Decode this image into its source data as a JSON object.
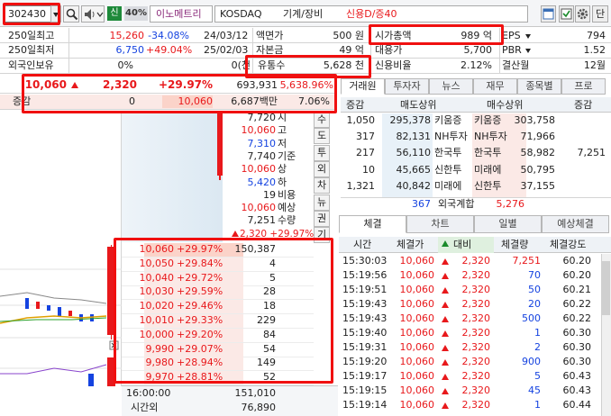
{
  "toolbar": {
    "code": "302430",
    "badge_sin": "신",
    "margin": "40%",
    "name": "이노메트리",
    "market": "KOSDAQ",
    "sector": "기계/장비",
    "credit": "신용D/증40",
    "dan": "단"
  },
  "info": {
    "row1": {
      "label": "250일최고",
      "price": "15,260",
      "pct": "-34.08%",
      "date": "24/03/12",
      "k2": "액면가",
      "v2": "500 원",
      "k3": "시가총액",
      "v3": "989 억",
      "k4": "EPS",
      "v4": "794"
    },
    "row2": {
      "label": "250일최저",
      "price": "6,750",
      "pct": "+49.04%",
      "date": "25/02/03",
      "k2": "자본금",
      "v2": "49 억",
      "k3": "대용가",
      "v3": "5,700",
      "k4": "PBR",
      "v4": "1.52"
    },
    "row3": {
      "label": "외국인보유",
      "v1": "0%",
      "v1b": "0(천",
      "k2": "유통수",
      "v2": "5,628 천",
      "k3": "신용비율",
      "v3": "2.12%",
      "k4": "결산월",
      "v4": "12월"
    }
  },
  "quote": {
    "price": "10,060",
    "change": "2,320",
    "change_pct": "+29.97%",
    "volume": "693,931",
    "vol_pct": "5,638.96%",
    "delta_label": "증감",
    "delta_v1": "0",
    "delta_v2": "10,060",
    "amount": "6,687백만",
    "ratio": "7.06%"
  },
  "summary": [
    {
      "v": "7,720",
      "k": "시"
    },
    {
      "v": "10,060",
      "k": "고"
    },
    {
      "v": "7,310",
      "k": "저"
    },
    {
      "v": "7,740",
      "k": "기준"
    },
    {
      "v": "10,060",
      "k": "상"
    },
    {
      "v": "5,420",
      "k": "하"
    },
    {
      "v": "19",
      "k": "비용"
    },
    {
      "v": "10,060",
      "k": "예상"
    },
    {
      "v": "7,251",
      "k": "수량"
    },
    {
      "v": "2,320 +29.97%",
      "k": ""
    }
  ],
  "vtabs": [
    "수",
    "도",
    "투",
    "외",
    "차",
    "뉴",
    "권",
    "기"
  ],
  "orderbook": [
    {
      "price": "10,060",
      "pct": "+29.97%",
      "qty": "150,387"
    },
    {
      "price": "10,050",
      "pct": "+29.84%",
      "qty": "4"
    },
    {
      "price": "10,040",
      "pct": "+29.72%",
      "qty": "5"
    },
    {
      "price": "10,030",
      "pct": "+29.59%",
      "qty": "28"
    },
    {
      "price": "10,020",
      "pct": "+29.46%",
      "qty": "18"
    },
    {
      "price": "10,010",
      "pct": "+29.33%",
      "qty": "229"
    },
    {
      "price": "10,000",
      "pct": "+29.20%",
      "qty": "84"
    },
    {
      "price": "9,990",
      "pct": "+29.07%",
      "qty": "54"
    },
    {
      "price": "9,980",
      "pct": "+28.94%",
      "qty": "149"
    },
    {
      "price": "9,970",
      "pct": "+28.81%",
      "qty": "52"
    }
  ],
  "ob_footer": {
    "time": "16:00:00",
    "time_label": "시간외",
    "total1": "151,010",
    "total2": "76,890"
  },
  "right_tabs": [
    "거래원",
    "투자자",
    "뉴스",
    "재무",
    "종목별",
    "프로"
  ],
  "broker_head": {
    "delta": "증감",
    "sell": "매도상위",
    "buy": "매수상위",
    "delta2": "증감"
  },
  "brokers": [
    {
      "sd": "1,050",
      "sq": "295,378",
      "sn": "키움증",
      "bn": "키움증",
      "bq": "303,758",
      "bd": ""
    },
    {
      "sd": "317",
      "sq": "82,131",
      "sn": "NH투자",
      "bn": "NH투자",
      "bq": "71,966",
      "bd": ""
    },
    {
      "sd": "217",
      "sq": "56,110",
      "sn": "한국투",
      "bn": "한국투",
      "bq": "58,982",
      "bd": "7,251"
    },
    {
      "sd": "10",
      "sq": "45,665",
      "sn": "신한투",
      "bn": "미래에",
      "bq": "50,795",
      "bd": ""
    },
    {
      "sd": "1,321",
      "sq": "40,842",
      "sn": "미래에",
      "bn": "신한투",
      "bq": "37,155",
      "bd": ""
    }
  ],
  "foreign": {
    "sell": "367",
    "label": "외국계합",
    "buy": "5,276"
  },
  "trade_tabs": [
    "체결",
    "차트",
    "일별",
    "예상체결"
  ],
  "trade_head": {
    "time": "시간",
    "price": "체결가",
    "change": "대비",
    "qty": "체결량",
    "strength": "체결강도"
  },
  "trades": [
    {
      "time": "15:30:03",
      "price": "10,060",
      "change": "2,320",
      "qty": "7,251",
      "qc": "red",
      "str": "60.20"
    },
    {
      "time": "15:19:56",
      "price": "10,060",
      "change": "2,320",
      "qty": "70",
      "qc": "blue",
      "str": "60.20"
    },
    {
      "time": "15:19:51",
      "price": "10,060",
      "change": "2,320",
      "qty": "50",
      "qc": "blue",
      "str": "60.21"
    },
    {
      "time": "15:19:43",
      "price": "10,060",
      "change": "2,320",
      "qty": "20",
      "qc": "blue",
      "str": "60.22"
    },
    {
      "time": "15:19:43",
      "price": "10,060",
      "change": "2,320",
      "qty": "500",
      "qc": "blue",
      "str": "60.22"
    },
    {
      "time": "15:19:40",
      "price": "10,060",
      "change": "2,320",
      "qty": "1",
      "qc": "blue",
      "str": "60.30"
    },
    {
      "time": "15:19:31",
      "price": "10,060",
      "change": "2,320",
      "qty": "2",
      "qc": "blue",
      "str": "60.30"
    },
    {
      "time": "15:19:20",
      "price": "10,060",
      "change": "2,320",
      "qty": "900",
      "qc": "blue",
      "str": "60.30"
    },
    {
      "time": "15:19:17",
      "price": "10,060",
      "change": "2,320",
      "qty": "5",
      "qc": "blue",
      "str": "60.43"
    },
    {
      "time": "15:19:15",
      "price": "10,060",
      "change": "2,320",
      "qty": "45",
      "qc": "blue",
      "str": "60.43"
    },
    {
      "time": "15:19:14",
      "price": "10,060",
      "change": "2,320",
      "qty": "1",
      "qc": "blue",
      "str": "60.44"
    }
  ],
  "colors": {
    "up": "#e8181b",
    "down": "#1543e0",
    "annotation": "#f01010",
    "sell_bg": "#e8f1f8",
    "buy_bg": "#fbe9e6"
  }
}
